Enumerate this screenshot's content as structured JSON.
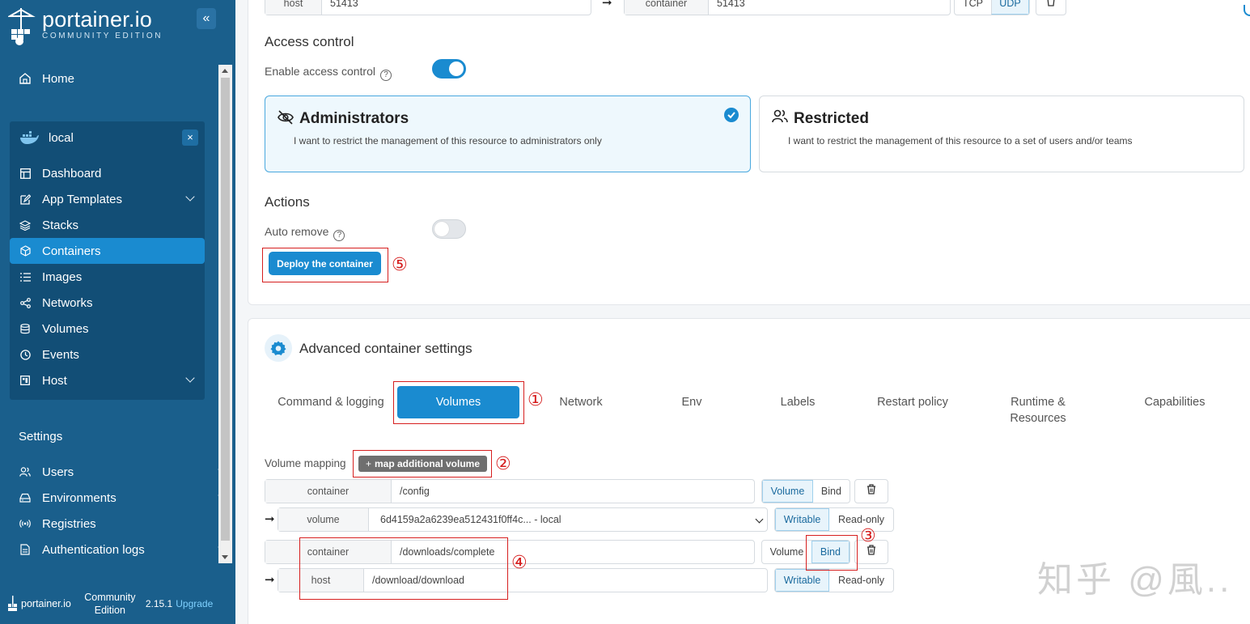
{
  "sidebar": {
    "logo_title": "portainer.io",
    "logo_subtitle": "COMMUNITY EDITION",
    "collapse_icon": "«",
    "home_label": "Home",
    "environment": {
      "name": "local",
      "close": "×"
    },
    "env_items": [
      {
        "label": "Dashboard",
        "icon": "dashboard-icon"
      },
      {
        "label": "App Templates",
        "icon": "edit-icon"
      },
      {
        "label": "Stacks",
        "icon": "layers-icon"
      },
      {
        "label": "Containers",
        "icon": "box-icon"
      },
      {
        "label": "Images",
        "icon": "list-icon"
      },
      {
        "label": "Networks",
        "icon": "share-icon"
      },
      {
        "label": "Volumes",
        "icon": "database-icon"
      },
      {
        "label": "Events",
        "icon": "clock-icon"
      },
      {
        "label": "Host",
        "icon": "server-icon"
      }
    ],
    "settings_title": "Settings",
    "settings_items": [
      {
        "label": "Users"
      },
      {
        "label": "Environments"
      },
      {
        "label": "Registries"
      },
      {
        "label": "Authentication logs"
      }
    ],
    "footer": {
      "brand": "portainer.io",
      "edition": "Community Edition",
      "version": "2.15.1",
      "upgrade": "Upgrade"
    }
  },
  "ports": {
    "host_label": "host",
    "host_value": "51413",
    "container_label": "container",
    "container_value": "51413",
    "tcp": "TCP",
    "udp": "UDP"
  },
  "access_control": {
    "title": "Access control",
    "enable_label": "Enable access control",
    "enabled": true,
    "admin": {
      "title": "Administrators",
      "desc": "I want to restrict the management of this resource to administrators only"
    },
    "restricted": {
      "title": "Restricted",
      "desc": "I want to restrict the management of this resource to a set of users and/or teams"
    }
  },
  "actions": {
    "title": "Actions",
    "auto_remove_label": "Auto remove",
    "auto_remove": false,
    "deploy_button": "Deploy the container",
    "deploy_marker": "⑤"
  },
  "advanced": {
    "title": "Advanced container settings",
    "tabs": [
      "Command & logging",
      "Volumes",
      "Network",
      "Env",
      "Labels",
      "Restart policy",
      "Runtime & Resources",
      "Capabilities"
    ],
    "active_tab": "Volumes",
    "tab_marker": "①",
    "volume_mapping_label": "Volume mapping",
    "map_button": "map additional volume",
    "map_marker": "②",
    "mappings": [
      {
        "container_label": "container",
        "container_path": "/config",
        "type_volume": "Volume",
        "type_bind": "Bind",
        "source_label": "volume",
        "source_value": "6d4159a2a6239ea512431f0ff4c... - local",
        "writable": "Writable",
        "readonly": "Read-only"
      },
      {
        "container_label": "container",
        "container_path": "/downloads/complete",
        "type_volume": "Volume",
        "type_bind": "Bind",
        "source_label": "host",
        "source_value": "/download/download",
        "writable": "Writable",
        "readonly": "Read-only"
      }
    ],
    "bind_marker": "③",
    "path_marker": "④"
  },
  "watermark": "知乎 @風..",
  "colors": {
    "sidebar": "#1a5f8c",
    "accent": "#1a8bd0",
    "annotation": "#d61f1f"
  }
}
